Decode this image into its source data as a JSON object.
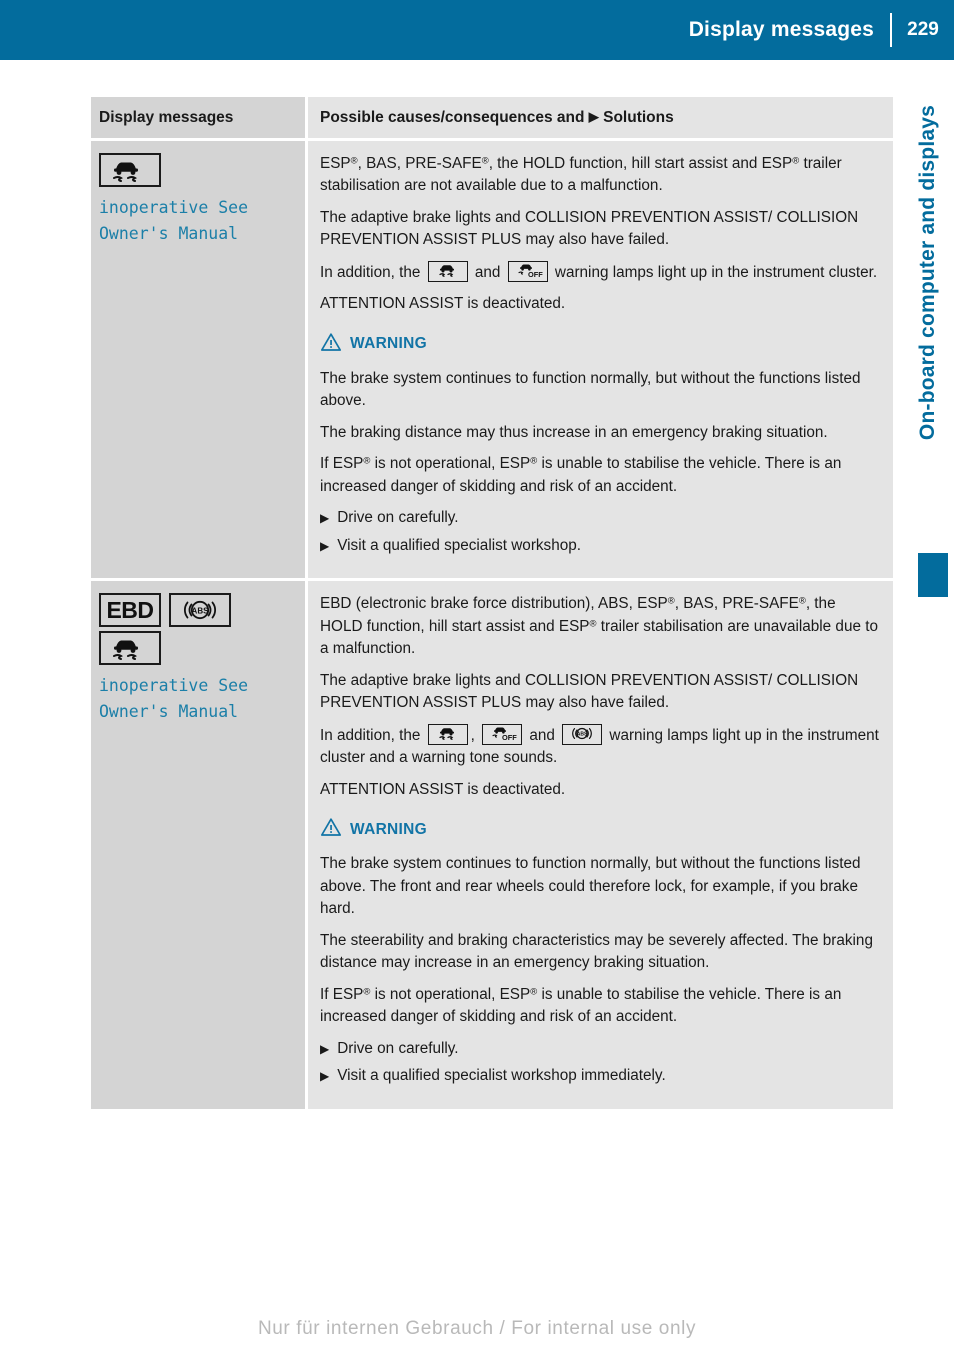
{
  "header": {
    "title": "Display messages",
    "page_number": "229"
  },
  "side_tab": {
    "chapter": "On-board computer and displays"
  },
  "table": {
    "columns": {
      "left": "Display messages",
      "right_prefix": "Possible causes/consequences and",
      "right_arrow": "▶",
      "right_suffix": "Solutions"
    },
    "rows": [
      {
        "icons": [
          "esp-skid-car-lamp"
        ],
        "message": "inoperative See\nOwner's Manual",
        "paragraphs": [
          "ESP®, BAS, PRE-SAFE®, the HOLD function, hill start assist and ESP® trailer stabilisation are not available due to a malfunction.",
          "The adaptive brake lights and COLLISION PREVENTION ASSIST/ COLLISION PREVENTION ASSIST PLUS may also have failed.",
          "In addition, the [esp-lamp] and [esp-off-lamp] warning lamps light up in the instrument cluster.",
          "ATTENTION ASSIST is deactivated."
        ],
        "warning_label": "WARNING",
        "warning_paragraphs": [
          "The brake system continues to function normally, but without the functions listed above.",
          "The braking distance may thus increase in an emergency braking situation.",
          "If ESP® is not operational, ESP® is unable to stabilise the vehicle. There is an increased danger of skidding and risk of an accident."
        ],
        "bullets": [
          "Drive on carefully.",
          "Visit a qualified specialist workshop."
        ]
      },
      {
        "icons": [
          "ebd-lamp",
          "abs-lamp",
          "esp-skid-car-lamp"
        ],
        "message": "inoperative See\nOwner's Manual",
        "paragraphs": [
          "EBD (electronic brake force distribution), ABS, ESP®, BAS, PRE-SAFE®, the HOLD function, hill start assist and ESP® trailer stabilisation are unavailable due to a malfunction.",
          "The adaptive brake lights and COLLISION PREVENTION ASSIST/ COLLISION PREVENTION ASSIST PLUS may also have failed.",
          "In addition, the [esp-lamp], [esp-off-lamp] and [abs-lamp] warning lamps light up in the instrument cluster and a warning tone sounds.",
          "ATTENTION ASSIST is deactivated."
        ],
        "warning_label": "WARNING",
        "warning_paragraphs": [
          "The brake system continues to function normally, but without the functions listed above. The front and rear wheels could therefore lock, for example, if you brake hard.",
          "The steerability and braking characteristics may be severely affected. The braking distance may increase in an emergency braking situation.",
          "If ESP® is not operational, ESP® is unable to stabilise the vehicle. There is an increased danger of skidding and risk of an accident."
        ],
        "bullets": [
          "Drive on carefully.",
          "Visit a qualified specialist workshop immediately."
        ]
      }
    ],
    "ebd_label": "EBD",
    "abs_label": "ABS",
    "esp_off_label": "OFF",
    "bullet_marker": "▶"
  },
  "footer": {
    "watermark": "Nur für internen Gebrauch / For internal use only"
  },
  "colors": {
    "brand_blue": "#036c9d",
    "message_blue": "#1b7fa8",
    "warning_blue": "#1274a6",
    "cell_left_bg": "#d4d4d4",
    "cell_right_bg": "#e4e4e4"
  }
}
